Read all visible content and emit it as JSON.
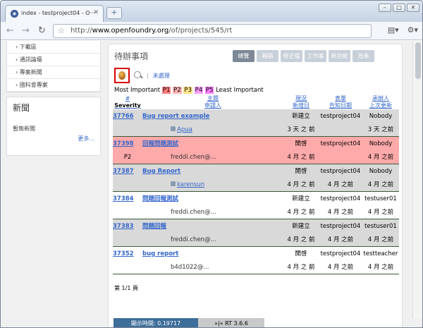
{
  "browser": {
    "tab_title": "index - testproject04 - O···",
    "url_prefix": "http://",
    "url_host": "www.openfoundry.org",
    "url_path": "/of/projects/545/rt"
  },
  "sidebar": {
    "links": [
      "下載區",
      "通訊論壇",
      "專案新聞",
      "國科會專案"
    ],
    "news_title": "新聞",
    "news_empty": "暫無新聞",
    "more": "更多..."
  },
  "main": {
    "title": "待辦事項",
    "tabs": [
      "總覽",
      "報錯",
      "修正檔",
      "工作事項",
      "新功能",
      "改進"
    ],
    "active_tab": "總覽",
    "unprocessed": "未處理",
    "legend_most": "Most Important",
    "legend_least": "Least Important",
    "legend_priorities": [
      "P1",
      "P2",
      "P3",
      "P4",
      "P5"
    ]
  },
  "table": {
    "headers": {
      "num": "#",
      "severity": "Severity",
      "subject": "主題",
      "requestor": "申請人",
      "status": "現況",
      "created": "新增日",
      "queue": "表單",
      "due": "告知日期",
      "owner": "承辦人",
      "updated": "上次更新"
    },
    "rows": [
      {
        "id": "37766",
        "subject": "Bug report example",
        "status": "新建立",
        "queue": "testproject04",
        "owner": "Nobody",
        "severity": "",
        "requestor": "Apua",
        "created": "3 天 之 前",
        "due": "",
        "updated": "3 天 之前",
        "style": "gray"
      },
      {
        "id": "37398",
        "subject": "回報問題測試",
        "status": "開啓",
        "queue": "testproject04",
        "owner": "Nobody",
        "severity": "P2",
        "requestor": "freddi.chen@...",
        "created": "4 月 之 前",
        "due": "",
        "updated": "4 月 之前",
        "style": "pink"
      },
      {
        "id": "37387",
        "subject": "Bug Report",
        "status": "開啓",
        "queue": "testproject04",
        "owner": "Nobody",
        "severity": "",
        "requestor": "karensun",
        "created": "4 月 之 前",
        "due": "4 月 之前",
        "updated": "4 月 之前",
        "style": "gray"
      },
      {
        "id": "37384",
        "subject": "問題回報測試",
        "status": "新建立",
        "queue": "testproject04",
        "owner": "testuser01",
        "severity": "",
        "requestor": "freddi.chen@...",
        "created": "4 月 之 前",
        "due": "4 月 之前",
        "updated": "4 月 之前",
        "style": "white"
      },
      {
        "id": "37383",
        "subject": "問題回報",
        "status": "新建立",
        "queue": "testproject04",
        "owner": "testuser01",
        "severity": "",
        "requestor": "freddi.chen@...",
        "created": "4 月 之 前",
        "due": "4 月 之前",
        "updated": "4 月 之前",
        "style": "gray"
      },
      {
        "id": "37352",
        "subject": "bug report",
        "status": "開啓",
        "queue": "testproject04",
        "owner": "testteacher",
        "severity": "",
        "requestor": "b4d1022@...",
        "created": "4 月 之 前",
        "due": "4 月 之前",
        "updated": "4 月 之前",
        "style": "white"
      }
    ],
    "pager": "第 1/1 頁"
  },
  "footer": {
    "time": "顯示時間: 0.19717",
    "version": "»|« RT 3.6.6"
  }
}
